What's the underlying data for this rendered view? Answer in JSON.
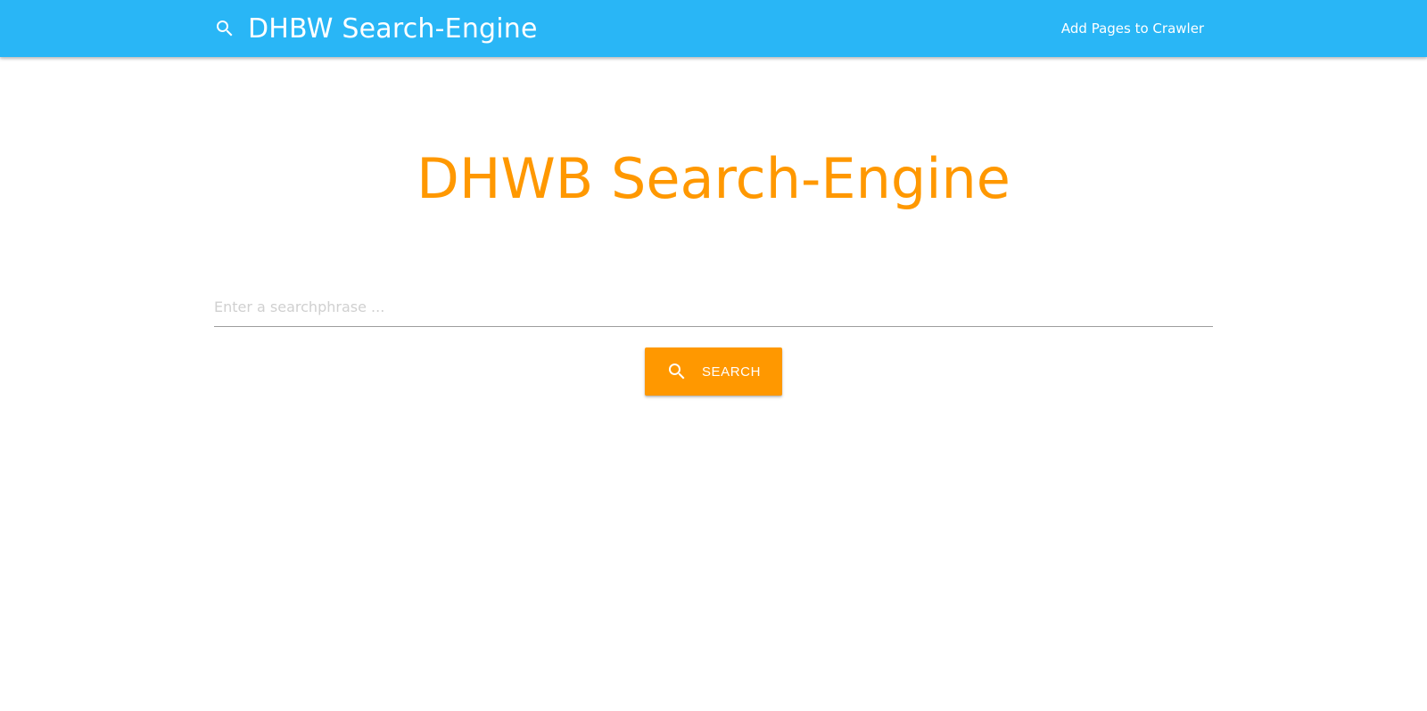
{
  "colors": {
    "navbar": "#29b6f6",
    "accent": "#ff9800",
    "text_on_accent": "#ffffff"
  },
  "navbar": {
    "brand_icon": "search-icon",
    "brand_title": "DHBW Search-Engine",
    "link_label": "Add Pages to Crawler"
  },
  "main": {
    "title": "DHWB Search-Engine",
    "search": {
      "placeholder": "Enter a searchphrase ...",
      "value": ""
    },
    "search_button": {
      "icon": "search-icon",
      "label": "SEARCH"
    }
  }
}
